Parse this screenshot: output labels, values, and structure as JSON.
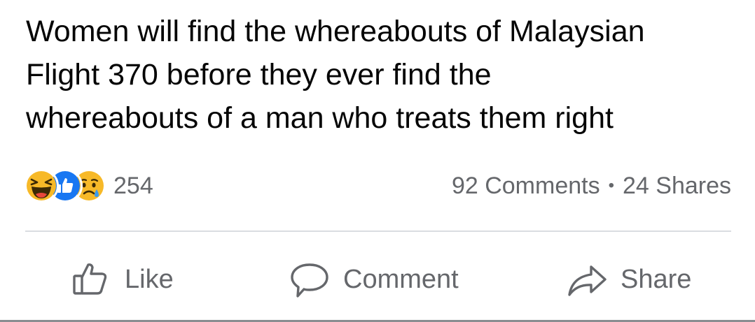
{
  "post": {
    "text_line1": "Women will find the whereabouts of Malaysian",
    "text_line2": "Flight 370 before they ever find the",
    "text_line3": "whereabouts of a man who treats them right"
  },
  "stats": {
    "reaction_count": "254",
    "reaction_icons": [
      "haha-icon",
      "like-icon",
      "sad-icon"
    ],
    "comments": "92 Comments",
    "separator": "•",
    "shares": "24 Shares"
  },
  "actions": {
    "like_label": "Like",
    "comment_label": "Comment",
    "share_label": "Share"
  },
  "colors": {
    "text": "#050505",
    "secondary_text": "#65676b",
    "like_blue": "#1877f2",
    "reaction_yellow": "#f7b928",
    "divider": "#dadde1"
  }
}
